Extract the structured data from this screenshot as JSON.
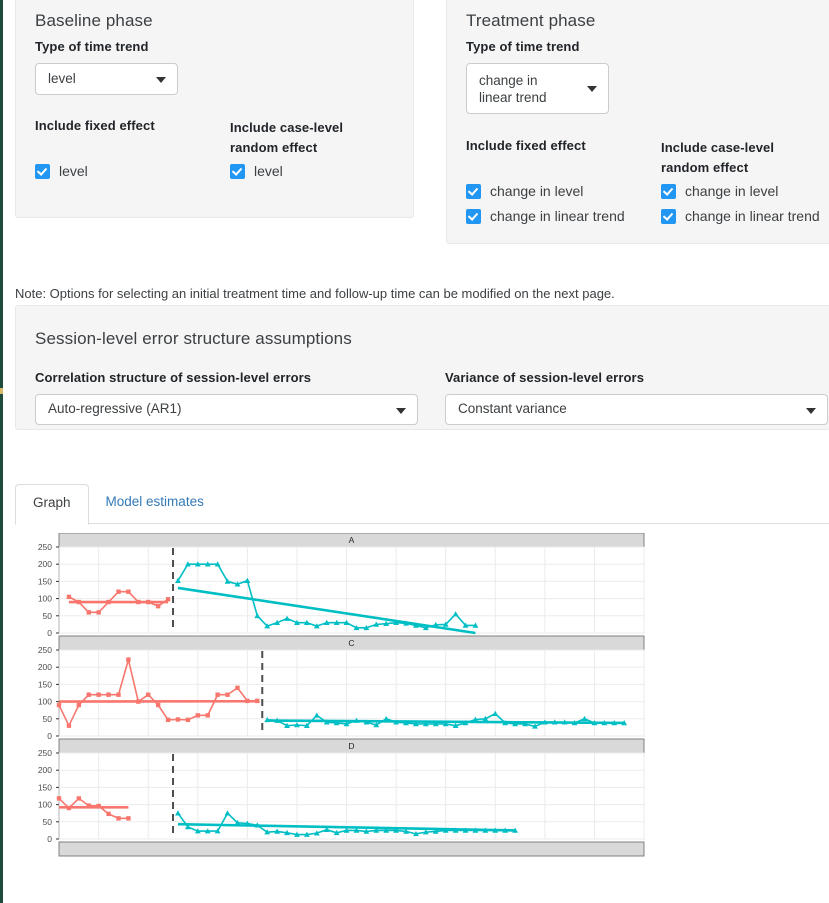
{
  "baseline_panel": {
    "title": "Baseline phase",
    "trend_label": "Type of time trend",
    "trend_value": "level",
    "fixed_label": "Include fixed effect",
    "random_label": "Include case-level random effect",
    "fixed_checks": [
      {
        "label": "level",
        "checked": true
      }
    ],
    "random_checks": [
      {
        "label": "level",
        "checked": true
      }
    ]
  },
  "treatment_panel": {
    "title": "Treatment phase",
    "trend_label": "Type of time trend",
    "trend_value": "change in linear trend",
    "fixed_label": "Include fixed effect",
    "random_label": "Include case-level random effect",
    "fixed_checks": [
      {
        "label": "change in level",
        "checked": true
      },
      {
        "label": "change in linear trend",
        "checked": true
      }
    ],
    "random_checks": [
      {
        "label": "change in level",
        "checked": true
      },
      {
        "label": "change in linear trend",
        "checked": true
      }
    ]
  },
  "note": "Note: Options for selecting an initial treatment time and follow-up time can be modified on the next page.",
  "error_panel": {
    "title": "Session-level error structure assumptions",
    "correlation_label": "Correlation structure of session-level errors",
    "correlation_value": "Auto-regressive (AR1)",
    "variance_label": "Variance of session-level errors",
    "variance_value": "Constant variance"
  },
  "tabs": [
    {
      "label": "Graph",
      "active": true
    },
    {
      "label": "Model estimates",
      "active": false
    }
  ],
  "colors": {
    "baseline_series": "#f8766d",
    "treatment_series": "#00bfc4",
    "phase_divider": "#4d4d4d",
    "strip_fill": "#d9d9d9",
    "checkbox_accent": "#2196f3",
    "tab_link": "#337ab7"
  },
  "chart_data": {
    "type": "line",
    "title": "",
    "xlabel": "",
    "ylabel": "",
    "ylim": [
      0,
      250
    ],
    "yticks": [
      0,
      50,
      100,
      150,
      200,
      250
    ],
    "grid": true,
    "legend": "none",
    "xlim": [
      1,
      60
    ],
    "panels": [
      {
        "strip_label": "A",
        "phase_change_session": 13,
        "baseline": {
          "name": "baseline phase",
          "color": "#f8766d",
          "x": [
            2,
            3,
            4,
            5,
            6,
            7,
            8,
            9,
            10,
            11,
            12
          ],
          "y": [
            105,
            90,
            60,
            60,
            90,
            120,
            120,
            90,
            90,
            78,
            98
          ]
        },
        "treatment": {
          "name": "treatment phase",
          "color": "#00bfc4",
          "x": [
            13,
            14,
            15,
            16,
            17,
            18,
            19,
            20,
            21,
            22,
            23,
            24,
            25,
            26,
            27,
            28,
            29,
            30,
            31,
            32,
            33,
            34,
            35,
            36,
            37,
            38,
            39,
            40,
            41,
            42,
            43
          ],
          "y": [
            152,
            200,
            200,
            200,
            200,
            150,
            142,
            152,
            50,
            20,
            30,
            42,
            30,
            30,
            20,
            30,
            30,
            30,
            15,
            15,
            25,
            27,
            30,
            28,
            22,
            15,
            24,
            25,
            55,
            22,
            22
          ]
        },
        "baseline_fit": {
          "x": [
            2,
            12
          ],
          "y": [
            90,
            90
          ]
        },
        "treatment_fit": {
          "x": [
            13,
            43
          ],
          "y": [
            131,
            -5
          ]
        }
      },
      {
        "strip_label": "C",
        "phase_change_session": 22,
        "baseline": {
          "name": "baseline phase",
          "color": "#f8766d",
          "x": [
            1,
            2,
            3,
            4,
            5,
            6,
            7,
            8,
            9,
            10,
            11,
            12,
            13,
            14,
            15,
            16,
            17,
            18,
            19,
            20,
            21
          ],
          "y": [
            90,
            30,
            90,
            120,
            120,
            120,
            120,
            222,
            100,
            120,
            90,
            47,
            48,
            47,
            60,
            60,
            120,
            120,
            140,
            102,
            102
          ]
        },
        "treatment": {
          "name": "treatment phase",
          "color": "#00bfc4",
          "x": [
            22,
            23,
            24,
            25,
            26,
            27,
            28,
            29,
            30,
            31,
            32,
            33,
            34,
            35,
            36,
            37,
            38,
            39,
            40,
            41,
            42,
            43,
            44,
            45,
            46,
            47,
            48,
            49,
            50,
            51,
            52,
            53,
            54,
            55,
            56,
            57,
            58
          ],
          "y": [
            47,
            45,
            30,
            32,
            30,
            60,
            40,
            38,
            35,
            45,
            40,
            32,
            50,
            40,
            38,
            35,
            35,
            35,
            35,
            30,
            38,
            48,
            50,
            65,
            38,
            35,
            35,
            28,
            40,
            40,
            40,
            38,
            50,
            38,
            38,
            38,
            38
          ]
        },
        "baseline_fit": {
          "x": [
            1,
            21
          ],
          "y": [
            100,
            101
          ]
        },
        "treatment_fit": {
          "x": [
            22,
            58
          ],
          "y": [
            45,
            38
          ]
        }
      },
      {
        "strip_label": "D",
        "phase_change_session": 13,
        "baseline": {
          "name": "baseline phase",
          "color": "#f8766d",
          "x": [
            1,
            2,
            3,
            4,
            5,
            6,
            7,
            8
          ],
          "y": [
            118,
            90,
            118,
            97,
            96,
            73,
            60,
            60
          ]
        },
        "treatment": {
          "name": "treatment phase",
          "color": "#00bfc4",
          "x": [
            13,
            14,
            15,
            16,
            17,
            18,
            19,
            20,
            21,
            22,
            23,
            24,
            25,
            26,
            27,
            28,
            29,
            30,
            31,
            32,
            33,
            34,
            35,
            36,
            37,
            38,
            39,
            40,
            41,
            42,
            43,
            44,
            45,
            46,
            47
          ],
          "y": [
            75,
            35,
            23,
            23,
            23,
            75,
            47,
            45,
            40,
            20,
            22,
            18,
            13,
            13,
            17,
            27,
            18,
            25,
            25,
            22,
            25,
            25,
            25,
            22,
            15,
            20,
            22,
            25,
            25,
            25,
            25,
            25,
            25,
            25,
            25
          ]
        },
        "baseline_fit": {
          "x": [
            1,
            8
          ],
          "y": [
            92,
            92
          ]
        },
        "treatment_fit": {
          "x": [
            13,
            47
          ],
          "y": [
            43,
            25
          ]
        }
      },
      {
        "strip_label": "",
        "partial": true
      }
    ]
  }
}
